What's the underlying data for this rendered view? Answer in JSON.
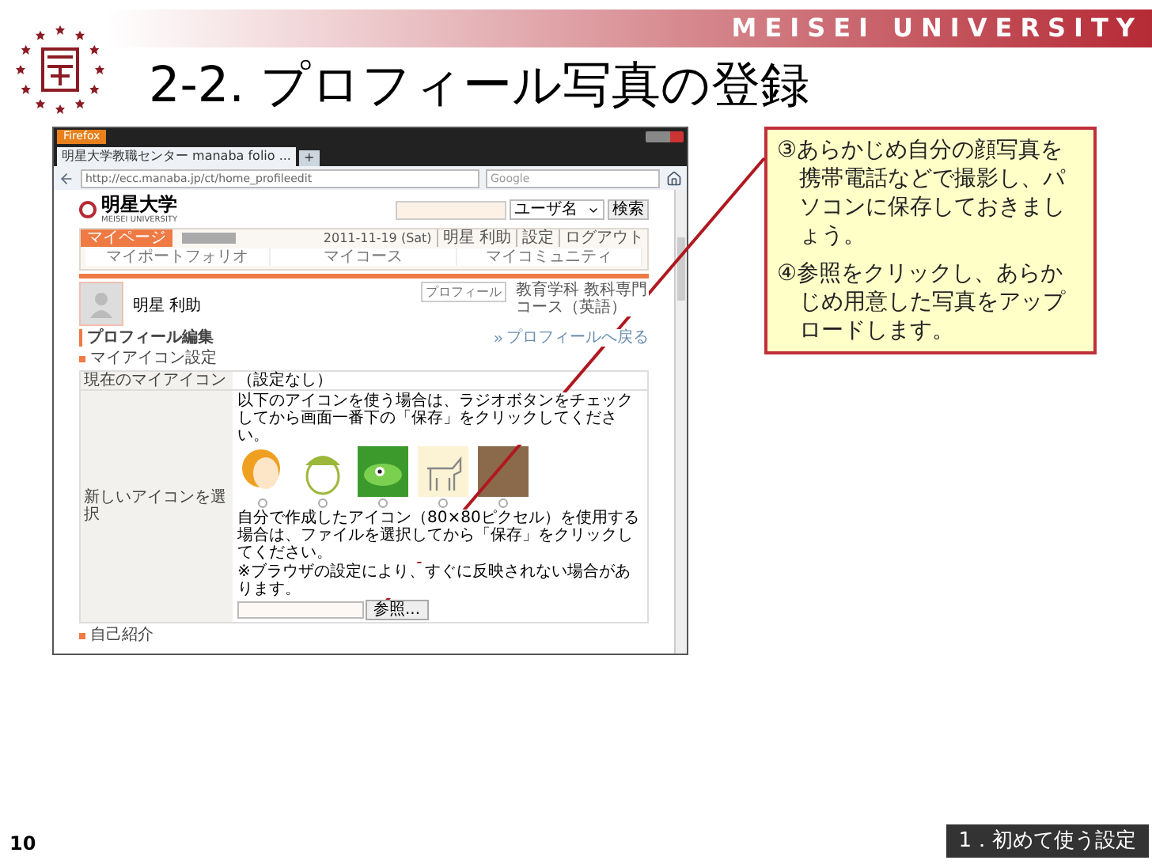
{
  "header": {
    "brand": "MEISEI UNIVERSITY",
    "title": "2-2. プロフィール写真の登録"
  },
  "browser": {
    "menu_button": "Firefox",
    "tab_title": "明星大学教職センター manaba folio ...",
    "new_tab": "+",
    "url": "http://ecc.manaba.jp/ct/home_profileedit",
    "search_engine": "Google"
  },
  "page": {
    "logo": "明星大学",
    "logo_sub": "MEISEI UNIVERSITY",
    "search_select": "ユーザ名",
    "search_button": "検索",
    "mypage_tab": "マイページ",
    "date": "2011-11-19 (Sat)",
    "user_links": [
      "明星 利助",
      "設定",
      "ログアウト"
    ],
    "nav": [
      {
        "label": "マイポートフォリオ"
      },
      {
        "label": "マイコース"
      },
      {
        "label": "マイコミュニティ"
      }
    ],
    "profile": {
      "name": "明星 利助",
      "tag": "プロフィール",
      "department": "教育学科 教科専門コース（英語）"
    },
    "section_title": "プロフィール編集",
    "back_link": "プロフィールへ戻る",
    "subsection": "マイアイコン設定",
    "current_icon": {
      "label": "現在のマイアイコン",
      "value": "（設定なし）"
    },
    "new_icon": {
      "label": "新しいアイコンを選択",
      "note": "以下のアイコンを使う場合は、ラジオボタンをチェックしてから画面一番下の「保存」をクリックしてください。",
      "icons": [
        {
          "kind": "woman",
          "selected": false
        },
        {
          "kind": "boy",
          "selected": false
        },
        {
          "kind": "frog",
          "selected": false
        },
        {
          "kind": "dog",
          "selected": false
        },
        {
          "kind": "cat",
          "selected": false
        }
      ],
      "upload_note": "自分で作成したアイコン（80×80ピクセル）を使用する場合は、ファイルを選択してから「保存」をクリックしてください。",
      "warning": "※ブラウザの設定により、すぐに反映されない場合があります。",
      "browse_button": "参照..."
    },
    "next_section": "自己紹介"
  },
  "callout": [
    "③あらかじめ自分の顔写真を携帯電話などで撮影し、パソコンに保存しておきましょう。",
    "④参照をクリックし、あらかじめ用意した写真をアップロードします。"
  ],
  "footer": {
    "page_number": "10",
    "section": "1．初めて使う設定"
  }
}
